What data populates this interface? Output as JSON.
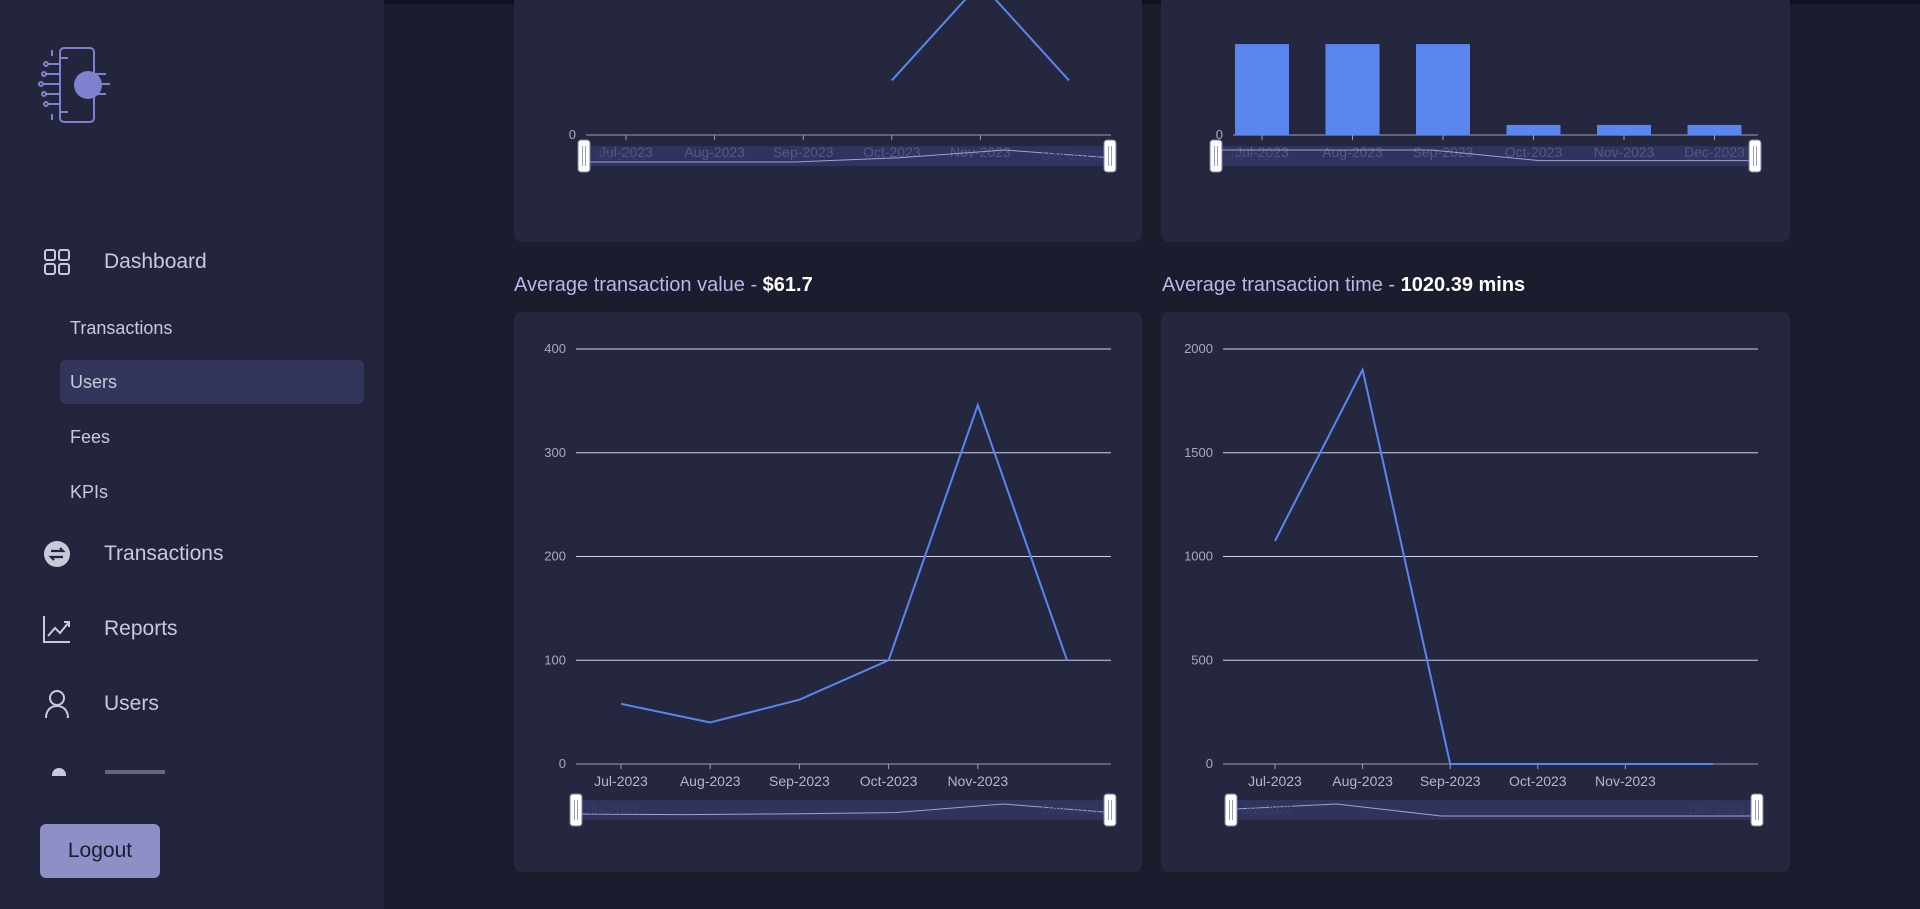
{
  "sidebar": {
    "nav": [
      {
        "label": "Dashboard",
        "icon": "grid-icon"
      },
      {
        "label": "Transactions",
        "icon": "exchange-icon"
      },
      {
        "label": "Reports",
        "icon": "trend-icon"
      },
      {
        "label": "Users",
        "icon": "user-icon"
      }
    ],
    "sub_items": [
      "Transactions",
      "Users",
      "Fees",
      "KPIs"
    ],
    "active_sub": "Users",
    "logout_label": "Logout"
  },
  "colors": {
    "accent": "#5b86f0",
    "background": "#1b1c2e",
    "panel": "#25273f",
    "sidebar": "#23253d",
    "active": "#33365a"
  },
  "sections": {
    "avg_value": {
      "label": "Average transaction value - ",
      "value": "$61.7"
    },
    "avg_time": {
      "label": "Average transaction time - ",
      "value": "1020.39 mins"
    }
  },
  "chart_data": [
    {
      "type": "line",
      "categories": [
        "Jul-2023",
        "Aug-2023",
        "Sep-2023",
        "Oct-2023",
        "Nov-2023"
      ],
      "values": [
        null,
        null,
        null,
        70,
        195,
        70
      ],
      "ylim": [
        0,
        250
      ],
      "yticks": [
        0
      ],
      "slider": {
        "start": "Jul-2023",
        "end": "Dec-2023"
      }
    },
    {
      "type": "bar",
      "categories": [
        "Jul-2023",
        "Aug-2023",
        "Sep-2023",
        "Oct-2023",
        "Nov-2023",
        "Dec-2023"
      ],
      "values": [
        9,
        9,
        9,
        1,
        1,
        1
      ],
      "ylim": [
        0,
        10
      ],
      "yticks": [
        0
      ],
      "slider": {
        "start": "Jul-2023",
        "end": "Dec-2023"
      }
    },
    {
      "type": "line",
      "categories": [
        "Jul-2023",
        "Aug-2023",
        "Sep-2023",
        "Oct-2023",
        "Nov-2023"
      ],
      "values": [
        58,
        40,
        62,
        100,
        346,
        100
      ],
      "ylim": [
        0,
        400
      ],
      "yticks": [
        0,
        100,
        200,
        300,
        400
      ],
      "slider": {
        "start": "Jul-2023",
        "end": "Dec-2023"
      }
    },
    {
      "type": "line",
      "categories": [
        "Jul-2023",
        "Aug-2023",
        "Sep-2023",
        "Oct-2023",
        "Nov-2023"
      ],
      "values": [
        1075,
        1900,
        0,
        0,
        0,
        0
      ],
      "ylim": [
        0,
        2000
      ],
      "yticks": [
        0,
        500,
        1000,
        1500,
        2000
      ],
      "slider": {
        "start": "Jul-2023",
        "end": "Dec-2023"
      }
    }
  ]
}
